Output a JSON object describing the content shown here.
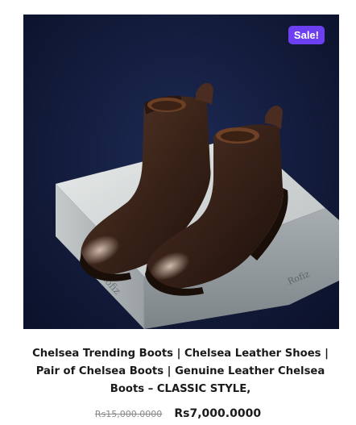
{
  "product": {
    "sale_badge": "Sale!",
    "title": "Chelsea Trending Boots | Chelsea Leather Shoes | Pair of Chelsea Boots | Genuine Leather Chelsea Boots – CLASSIC STYLE,",
    "price_regular": "Rs15,000.0000",
    "price_sale": "Rs7,000.0000",
    "box_brand_text": "Rofiz"
  },
  "colors": {
    "sale_badge": "#6c3ff0",
    "background": "#131c3c",
    "leather": "#3a2219"
  }
}
